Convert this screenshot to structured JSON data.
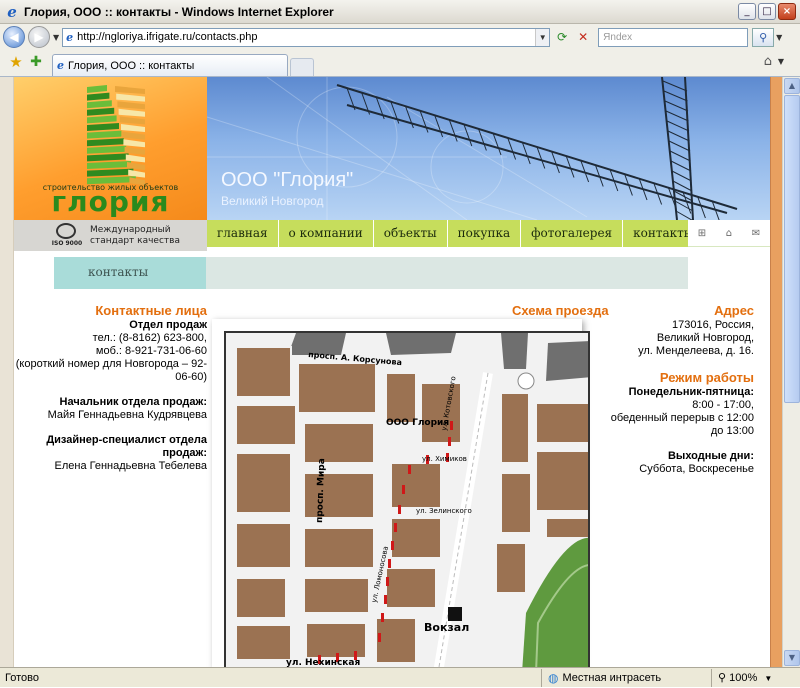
{
  "window": {
    "title": "Глория, ООО :: контакты - Windows Internet Explorer",
    "minimize": "_",
    "maximize": "□",
    "close": "×"
  },
  "address_bar": {
    "url": "http://ngloriya.ifrigate.ru/contacts.php",
    "search_placeholder": "Яndex"
  },
  "tabs": [
    {
      "label": "Глория, ООО :: контакты"
    }
  ],
  "site": {
    "logo_tagline": "строительство жилых объектов",
    "logo_name": "глория",
    "iso_badge": "ISO 9000",
    "iso_label_line1": "Международный",
    "iso_label_line2": "стандарт качества",
    "company_name": "ООО \"Глория\"",
    "city": "Великий Новгород",
    "nav": [
      {
        "label": "главная"
      },
      {
        "label": "о компании"
      },
      {
        "label": "объекты"
      },
      {
        "label": "покупка"
      },
      {
        "label": "фотогалерея"
      },
      {
        "label": "контакты"
      }
    ],
    "breadcrumb": "контакты"
  },
  "contacts": {
    "heading": "Контактные лица",
    "sales_title": "Отдел продаж",
    "tel": "тел.: (8-8162) 623-800,",
    "mob": "моб.: 8-921-731-06-60",
    "short_number": "(короткий номер для Новгорода – 92-06-60)",
    "head_title": "Начальник отдела продаж:",
    "head_name": "Майя Геннадьевна Кудрявцева",
    "designer_title": "Дизайнер-специалист отдела продаж:",
    "designer_name": "Елена Геннадьевна Тебелева"
  },
  "map": {
    "heading": "Схема проезда",
    "labels": {
      "korsunova": "просп. А. Корсунова",
      "gloria": "ООО Глория",
      "himikov": "ул. Химиков",
      "zelinskogo": "ул. Зелинского",
      "mira": "просп. Мира",
      "lomonosova": "ул. Ломоносова",
      "nehinskaya": "ул. Нехинская",
      "vokzal": "Вокзал",
      "kotovskogo": "ул. Котовского"
    }
  },
  "address": {
    "heading": "Адрес",
    "line1": "173016, Россия,",
    "line2": "Великий Новгород,",
    "line3": "ул. Менделеева, д. 16."
  },
  "hours": {
    "heading": "Режим работы",
    "weekdays_title": "Понедельник-пятница:",
    "weekdays_time": "8:00 - 17:00,",
    "lunch": "обеденный перерыв с 12:00",
    "lunch_end": "до 13:00",
    "weekend_title": "Выходные дни:",
    "weekend_days": "Суббота, Воскресенье"
  },
  "status_bar": {
    "text": "Готово",
    "zone": "Местная интрасеть",
    "zoom": "100%"
  },
  "colors": {
    "accent_orange": "#e36f0f",
    "nav_green": "#c6dd5c",
    "logo_green": "#2a8a1d",
    "breadcrumb_teal": "#a9dcd9",
    "map_block": "#9b7252"
  }
}
